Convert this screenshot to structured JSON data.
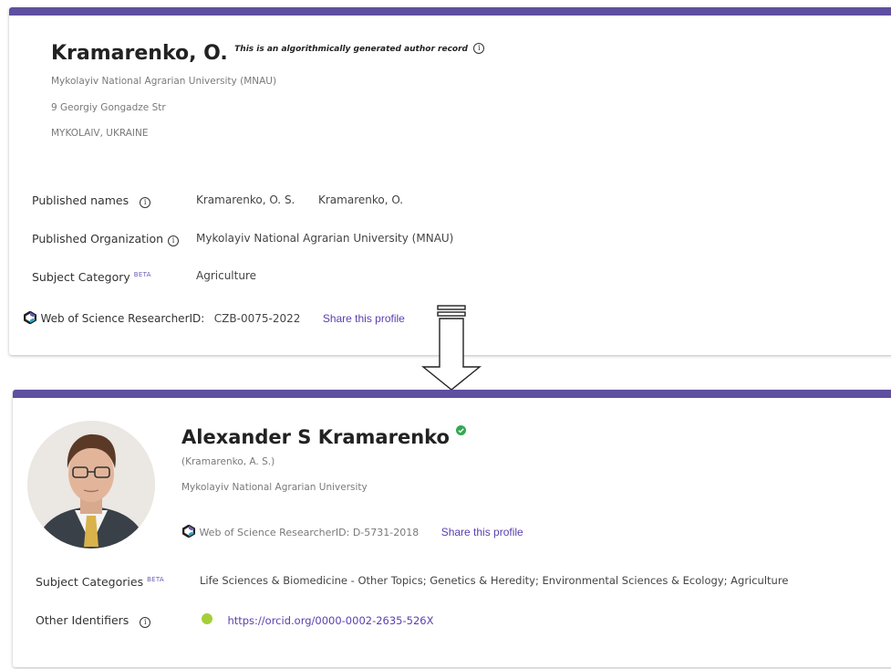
{
  "record_top": {
    "name": "Kramarenko, O.",
    "algo_note": "This is an algorithmically generated author record",
    "institution": "Mykolayiv National Agrarian University (MNAU)",
    "address": "9 Georgiy Gongadze Str",
    "city": "MYKOLAIV, UKRAINE",
    "published_names_label": "Published names",
    "published_names": [
      "Kramarenko, O. S.",
      "Kramarenko, O."
    ],
    "published_org_label": "Published Organization",
    "published_org": "Mykolayiv National Agrarian University (MNAU)",
    "subject_label": "Subject Category",
    "beta": "BETA",
    "subject": "Agriculture",
    "researcher_id_label": "Web of Science ResearcherID:",
    "researcher_id": "CZB-0075-2022",
    "share": "Share this profile"
  },
  "record_bottom": {
    "name": "Alexander S Kramarenko",
    "alt_name": "(Kramarenko, A. S.)",
    "institution": "Mykolayiv National Agrarian University",
    "researcher_id_text": "Web of Science ResearcherID: D-5731-2018",
    "share": "Share this profile",
    "subject_label": "Subject Categories",
    "beta": "BETA",
    "subjects": "Life Sciences & Biomedicine - Other Topics;  Genetics & Heredity;  Environmental Sciences & Ecology;  Agriculture",
    "other_ids_label": "Other Identifiers",
    "orcid_url": "https://orcid.org/0000-0002-2635-526X"
  },
  "colors": {
    "topbar": "#5e4fa0",
    "link": "#5a3fb0",
    "verified": "#34a853",
    "orcid": "#a6ce39"
  },
  "icons": [
    "info-icon",
    "wos-logo-icon",
    "verified-check-icon",
    "orcid-icon",
    "down-arrow-icon"
  ]
}
